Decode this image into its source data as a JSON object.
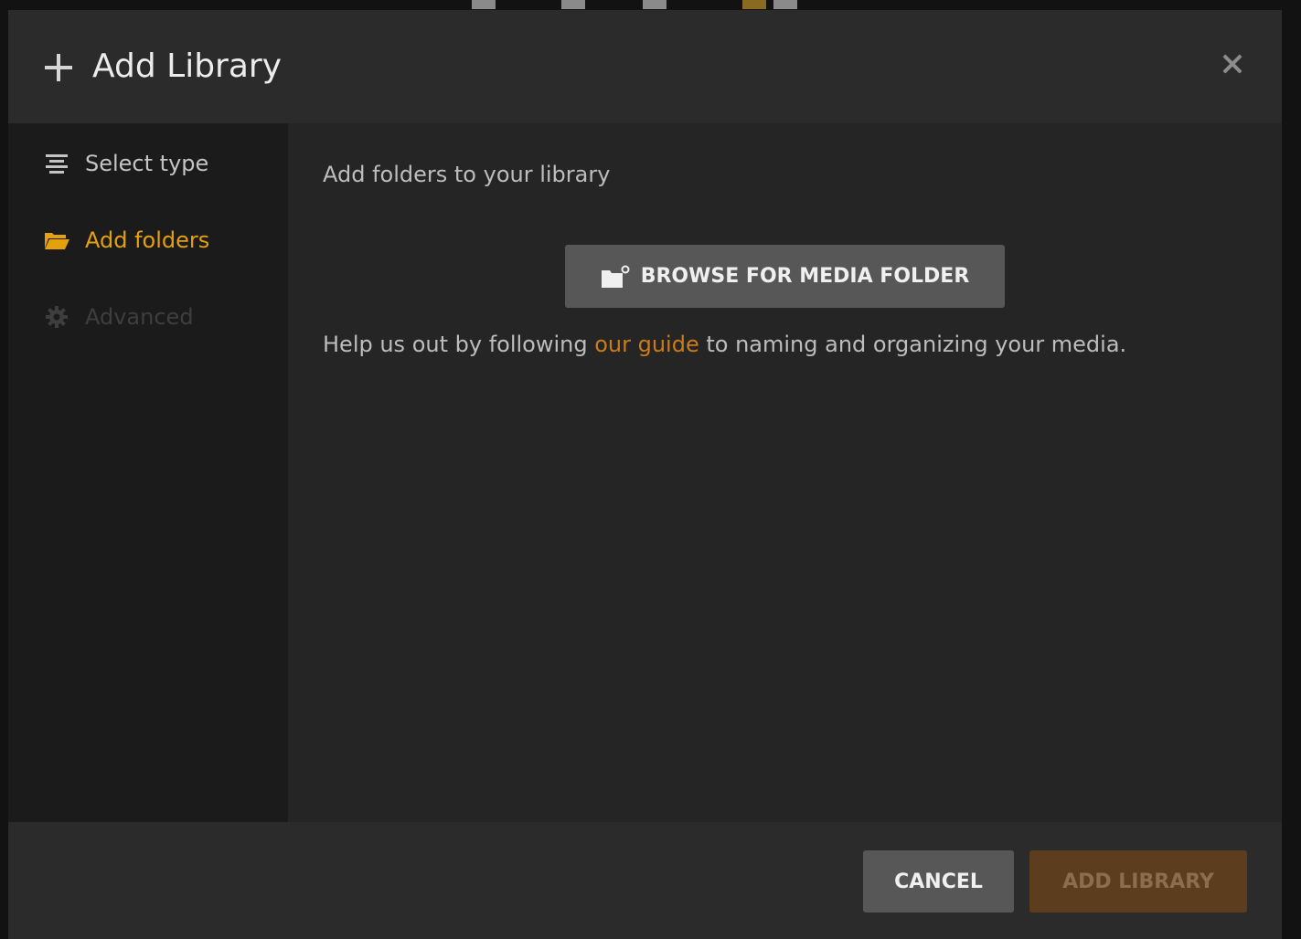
{
  "modal": {
    "title": "Add Library",
    "icons": {
      "title": "plus-icon",
      "close": "close-icon"
    }
  },
  "sidebar": {
    "items": [
      {
        "label": "Select type",
        "icon": "list-icon",
        "state": "completed"
      },
      {
        "label": "Add folders",
        "icon": "folder-open-icon",
        "state": "active"
      },
      {
        "label": "Advanced",
        "icon": "gear-icon",
        "state": "disabled"
      }
    ]
  },
  "main": {
    "heading": "Add folders to your library",
    "browse_label": "BROWSE FOR MEDIA FOLDER",
    "browse_icon": "folder-add-icon",
    "help_prefix": "Help us out by following ",
    "help_link": "our guide",
    "help_suffix": " to naming and organizing your media."
  },
  "footer": {
    "cancel_label": "CANCEL",
    "add_label": "ADD LIBRARY"
  },
  "colors": {
    "accent": "#e5a00d",
    "link": "#cc7b19",
    "button": "#575757",
    "primary_disabled": "#5c3e1f"
  }
}
